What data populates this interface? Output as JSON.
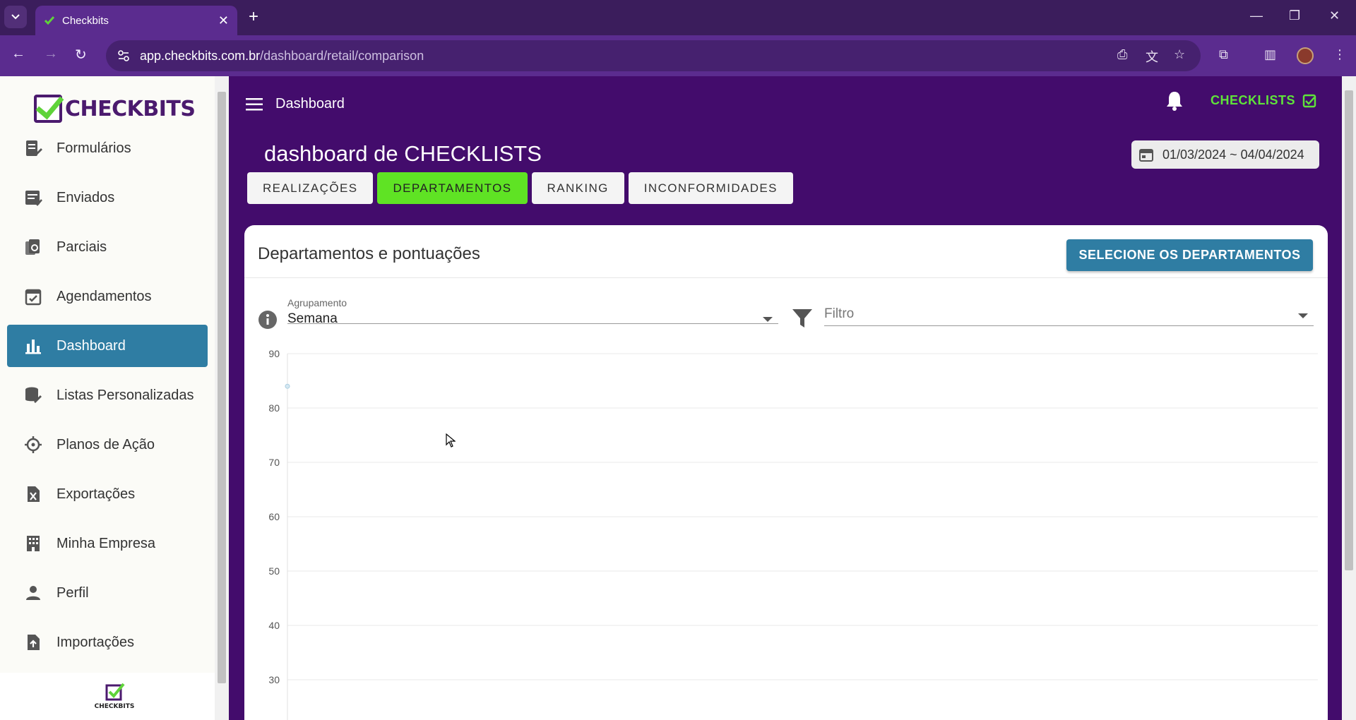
{
  "browser": {
    "tab_title": "Checkbits",
    "url_host": "app.checkbits.com.br",
    "url_path": "/dashboard/retail/comparison"
  },
  "sidebar": {
    "logo_text": "CHECKBITS",
    "items": [
      {
        "label": "Formulários",
        "icon": "form-edit-icon"
      },
      {
        "label": "Enviados",
        "icon": "sent-list-icon"
      },
      {
        "label": "Parciais",
        "icon": "partial-docs-icon"
      },
      {
        "label": "Agendamentos",
        "icon": "calendar-check-icon"
      },
      {
        "label": "Dashboard",
        "icon": "bar-chart-icon",
        "active": true
      },
      {
        "label": "Listas Personalizadas",
        "icon": "database-edit-icon"
      },
      {
        "label": "Planos de Ação",
        "icon": "crosshair-icon"
      },
      {
        "label": "Exportações",
        "icon": "excel-file-icon"
      },
      {
        "label": "Minha Empresa",
        "icon": "building-icon"
      },
      {
        "label": "Perfil",
        "icon": "person-icon"
      },
      {
        "label": "Importações",
        "icon": "upload-file-icon"
      }
    ],
    "bottom_logo_text": "CHECKBITS"
  },
  "topbar": {
    "title": "Dashboard",
    "checklists_label": "CHECKLISTS"
  },
  "page": {
    "title": "dashboard de CHECKLISTS",
    "date_range": "01/03/2024 ~ 04/04/2024",
    "tabs": [
      "REALIZAÇÕES",
      "DEPARTAMENTOS",
      "RANKING",
      "INCONFORMIDADES"
    ],
    "active_tab": "DEPARTAMENTOS"
  },
  "card": {
    "title": "Departamentos e pontuações",
    "select_button": "SELECIONE OS DEPARTAMENTOS",
    "grouping_label": "Agrupamento",
    "grouping_value": "Semana",
    "filter_placeholder": "Filtro"
  },
  "chart_data": {
    "type": "line",
    "ylim": [
      30,
      90
    ],
    "yticks": [
      90,
      80,
      70,
      60,
      50,
      40,
      30
    ],
    "series": [
      {
        "values": [
          84
        ]
      }
    ],
    "grid": true
  },
  "colors": {
    "primary_purple": "#430c6c",
    "accent_green": "#5fe324",
    "accent_blue": "#2f7da3"
  }
}
